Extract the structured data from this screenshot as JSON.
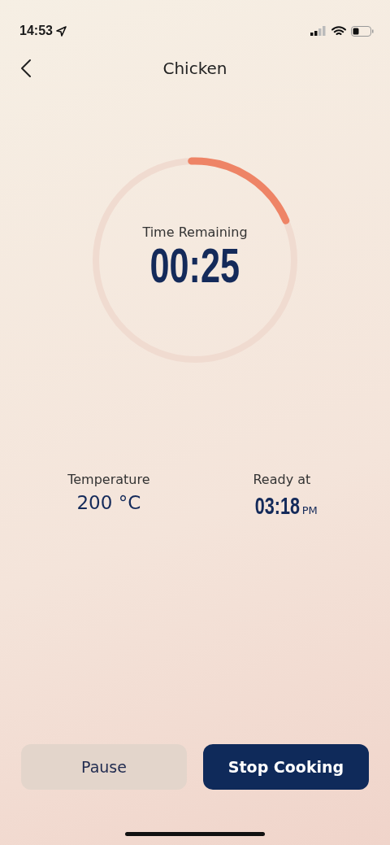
{
  "status_bar": {
    "time": "14:53"
  },
  "nav": {
    "title": "Chicken"
  },
  "timer": {
    "label": "Time Remaining",
    "value": "00:25"
  },
  "stats": [
    {
      "kind": "plain",
      "label": "Temperature",
      "value": "200 °C"
    },
    {
      "kind": "time",
      "label": "Ready at",
      "value": "03:18",
      "suffix": "PM"
    }
  ],
  "buttons": [
    {
      "kind": "secondary",
      "label": "Pause"
    },
    {
      "kind": "primary",
      "label": "Stop Cooking"
    }
  ]
}
